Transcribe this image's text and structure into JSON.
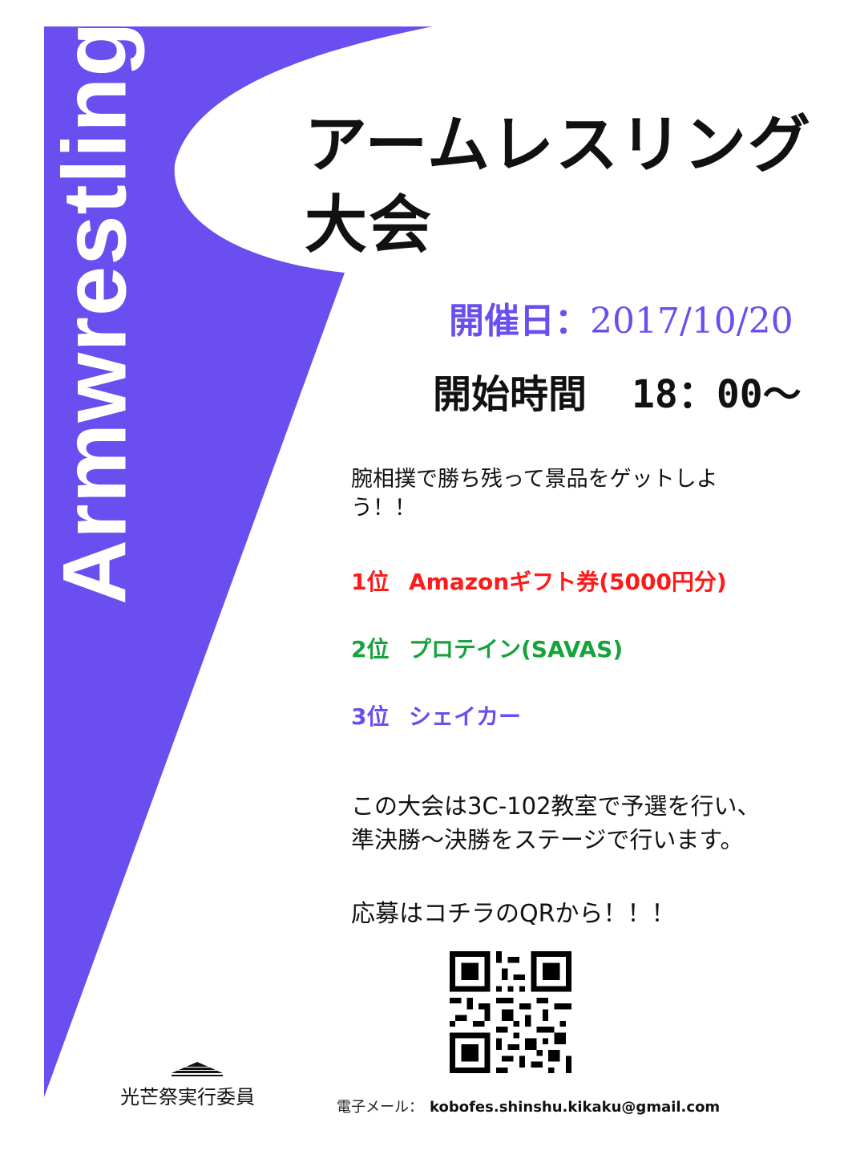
{
  "side_title": "Armwrestling",
  "title": {
    "line1": "アームレスリング",
    "line2": "大会"
  },
  "event": {
    "date_label": "開催日：",
    "date": "2017/10/20",
    "time_label": "開始時間",
    "time": "18：00～"
  },
  "intro": "腕相撲で勝ち残って景品をゲットしよう！！",
  "prizes": [
    {
      "rank": "1位",
      "item": "Amazonギフト券(5000円分)",
      "color": "#ff1a1a"
    },
    {
      "rank": "2位",
      "item": "プロテイン(SAVAS)",
      "color": "#17a33b"
    },
    {
      "rank": "3位",
      "item": "シェイカー",
      "color": "#6a4ef0"
    }
  ],
  "description": {
    "line1": "この大会は3C-102教室で予選を行い、",
    "line2": "準決勝～決勝をステージで行います。"
  },
  "apply": "応募はコチラのQRから！！！",
  "committee": "光芒祭実行委員",
  "email": {
    "label": "電子メール：",
    "value": "kobofes.shinshu.kikaku@gmail.com"
  },
  "colors": {
    "accent": "#6a4ef0"
  }
}
